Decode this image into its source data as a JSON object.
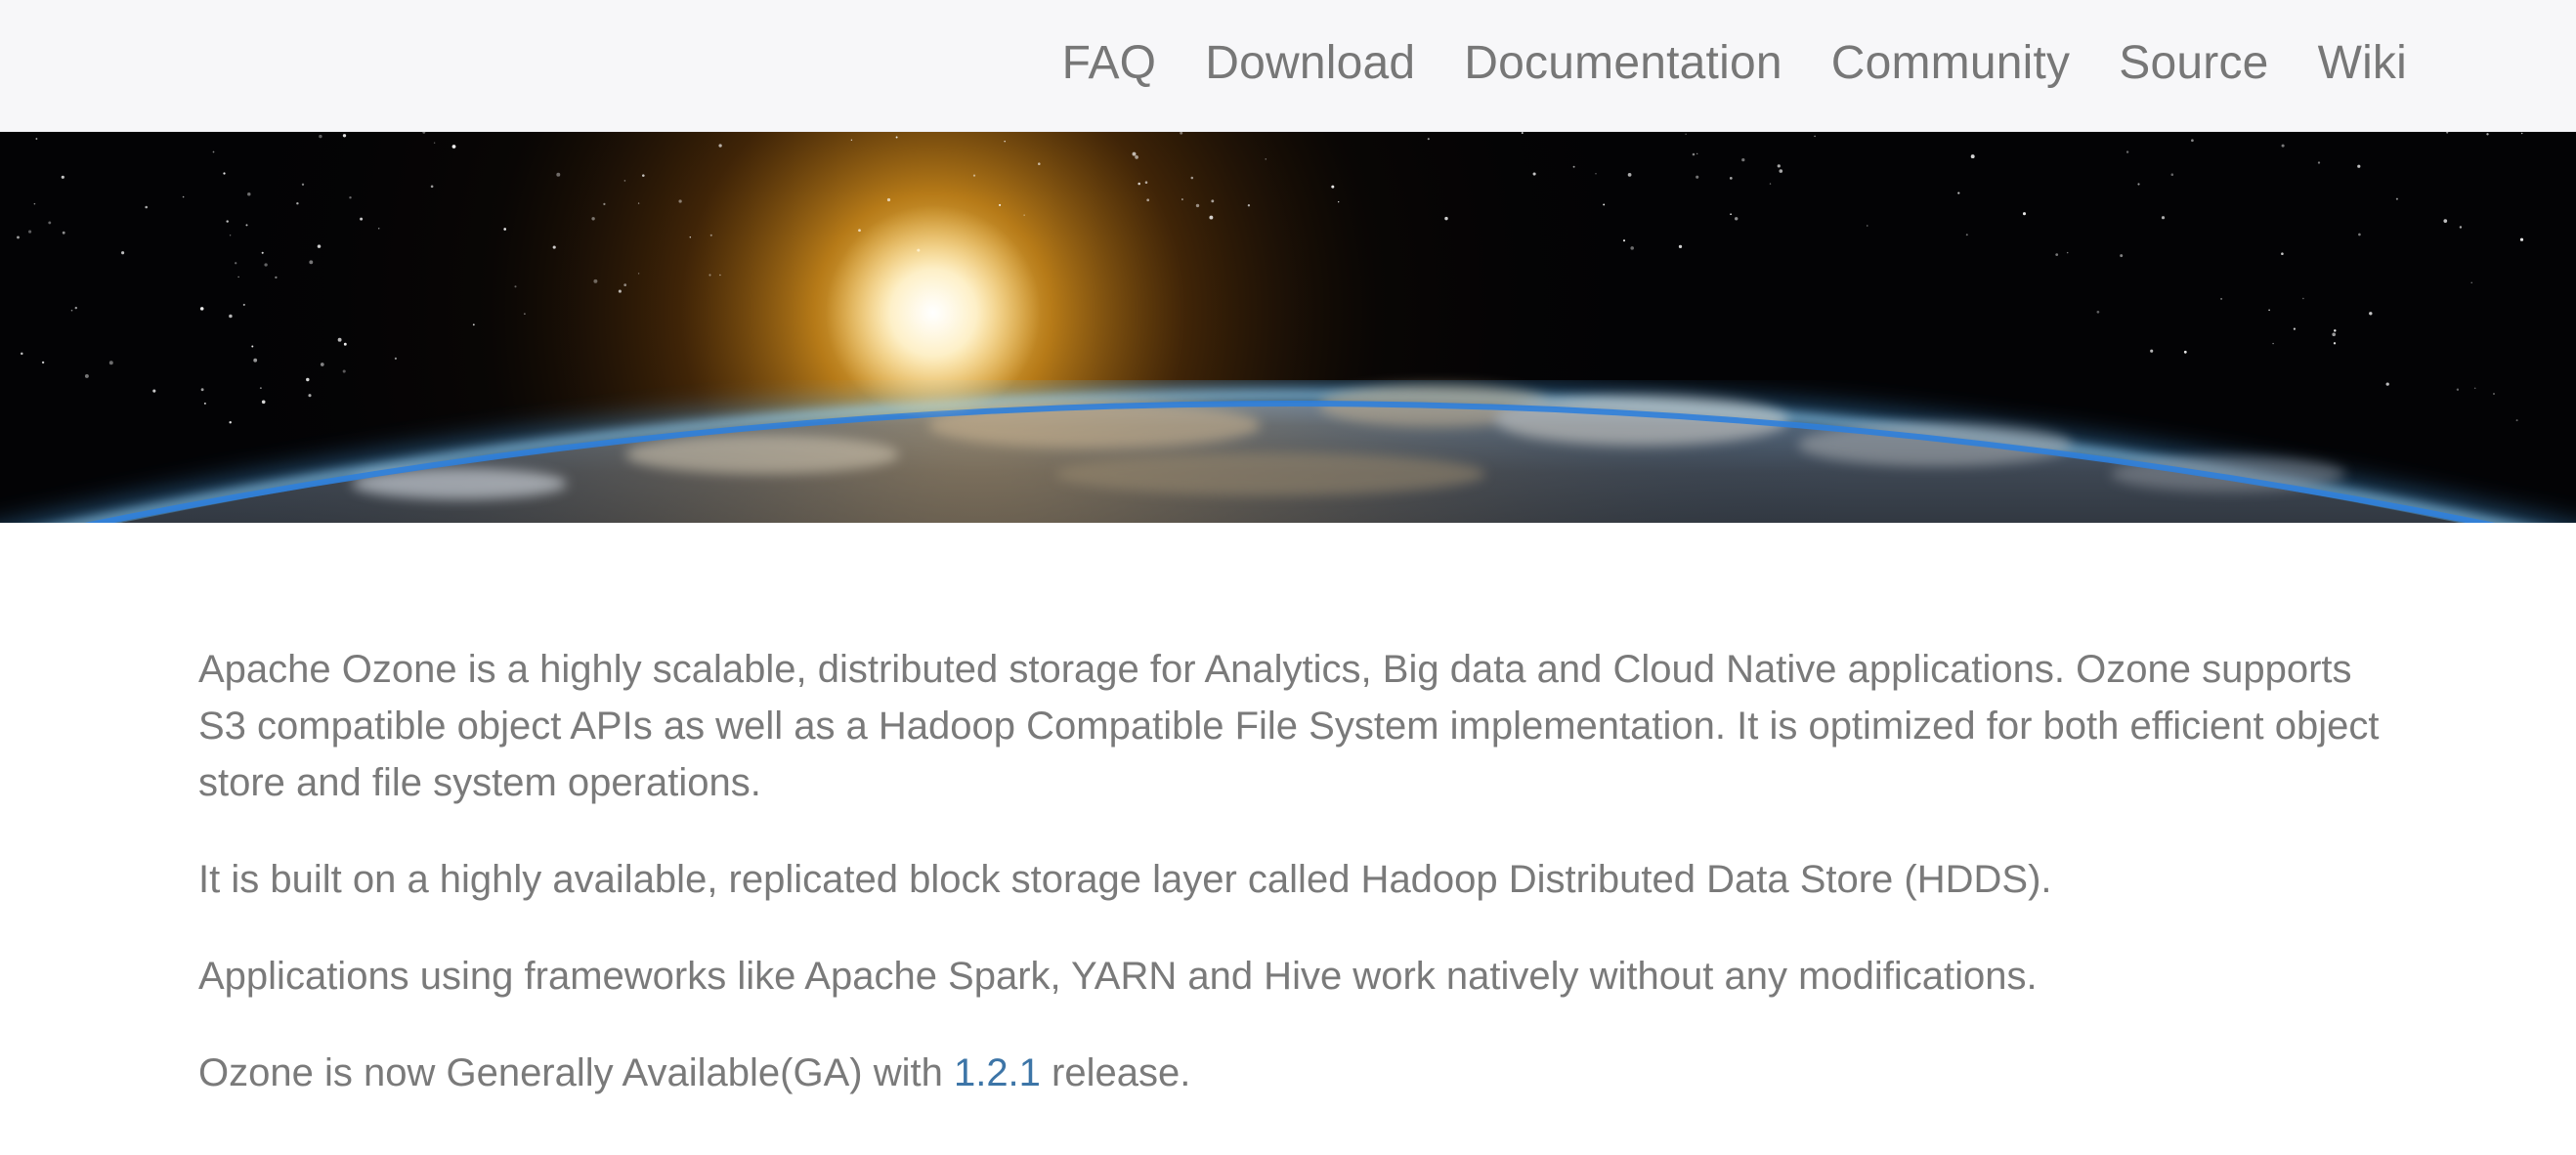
{
  "nav": {
    "items": [
      {
        "label": "FAQ"
      },
      {
        "label": "Download"
      },
      {
        "label": "Documentation"
      },
      {
        "label": "Community"
      },
      {
        "label": "Source"
      },
      {
        "label": "Wiki"
      }
    ]
  },
  "hero": {
    "image": "earth-horizon-sunrise"
  },
  "content": {
    "intro": "Apache Ozone is a highly scalable, distributed storage for Analytics, Big data and Cloud Native applications. Ozone supports S3 compatible object APIs as well as a Hadoop Compatible File System implementation. It is optimized for both efficient object store and file system operations.",
    "hdds": "It is built on a highly available, replicated block storage layer called Hadoop Distributed Data Store (HDDS).",
    "frameworks": "Applications using frameworks like Apache Spark, YARN and Hive work natively without any modifications.",
    "ga_prefix": "Ozone is now Generally Available(GA) with ",
    "ga_link": "1.2.1",
    "ga_suffix": " release."
  },
  "colors": {
    "nav_background": "#f7f7f9",
    "nav_text": "#777777",
    "body_text": "#7a7a7a",
    "link": "#3d75a7"
  }
}
